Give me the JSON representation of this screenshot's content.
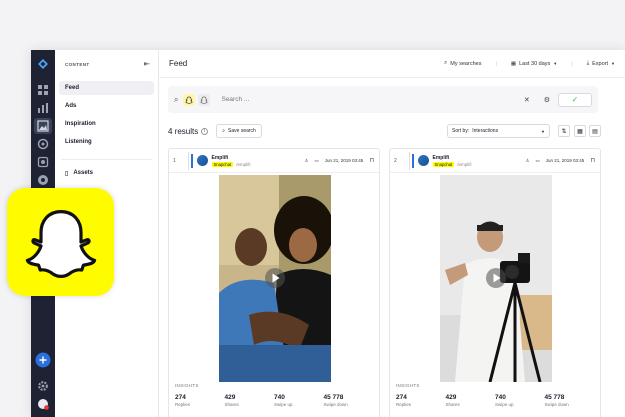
{
  "sidenav": {
    "header": "CONTENT",
    "items": [
      {
        "label": "Feed",
        "active": true
      },
      {
        "label": "Ads",
        "active": false
      },
      {
        "label": "Inspiration",
        "active": false
      },
      {
        "label": "Listening",
        "active": false
      },
      {
        "label": "Assets",
        "active": false
      }
    ]
  },
  "topbar": {
    "title": "Feed",
    "my_searches": "My searches",
    "date_range": "Last 30 days",
    "export": "Export"
  },
  "search": {
    "placeholder": "Search ..."
  },
  "results": {
    "count": "4 results",
    "save_label": "Save search",
    "sort_prefix": "Sort by:",
    "sort_value": "Interactions"
  },
  "cards": [
    {
      "index": "1",
      "author": "Emplifi",
      "network": "Snapchat",
      "handle": "/emplifi",
      "date": "Jun 21, 2019 03:45",
      "insights_label": "INSIGHTS",
      "stats": [
        {
          "value": "274",
          "label": "Replies"
        },
        {
          "value": "429",
          "label": "Shares"
        },
        {
          "value": "740",
          "label": "Swipe up"
        },
        {
          "value": "45 778",
          "label": "Swipe down"
        }
      ]
    },
    {
      "index": "2",
      "author": "Emplifi",
      "network": "Snapchat",
      "handle": "/emplifi",
      "date": "Jun 21, 2019 03:45",
      "insights_label": "INSIGHTS",
      "stats": [
        {
          "value": "274",
          "label": "Replies"
        },
        {
          "value": "429",
          "label": "Shares"
        },
        {
          "value": "740",
          "label": "Swipe up"
        },
        {
          "value": "45 778",
          "label": "Swipe down"
        }
      ]
    }
  ],
  "colors": {
    "rail": "#1e2233",
    "snapchat_yellow": "#fffc00",
    "accent_blue": "#2a6fdb",
    "success": "#4caf50"
  }
}
